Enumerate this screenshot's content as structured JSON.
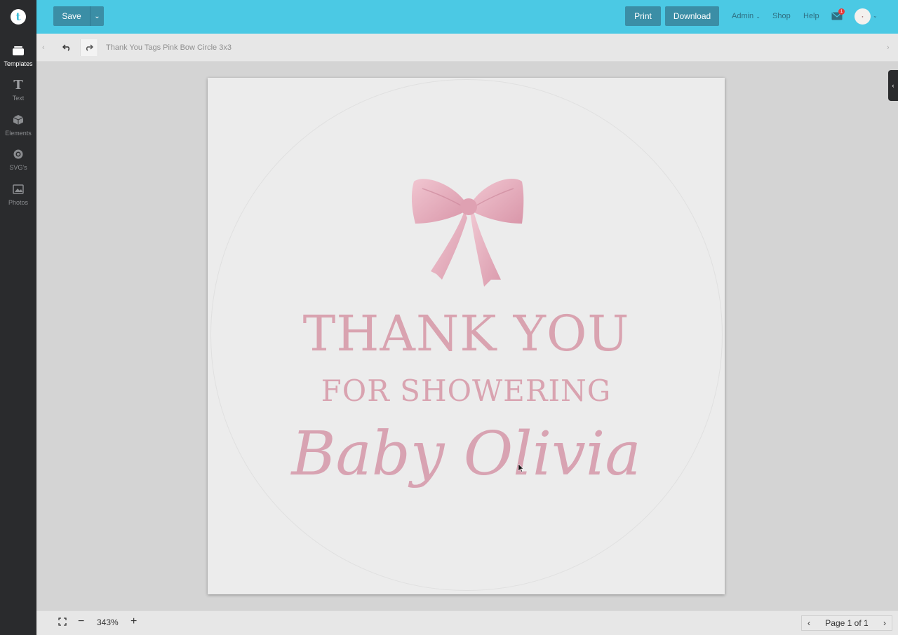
{
  "app": {
    "logo_letter": "t"
  },
  "sidebar": {
    "items": [
      {
        "label": "Templates",
        "icon": "templates-icon",
        "active": true
      },
      {
        "label": "Text",
        "icon": "text-icon",
        "active": false
      },
      {
        "label": "Elements",
        "icon": "elements-icon",
        "active": false
      },
      {
        "label": "SVG's",
        "icon": "svg-icon",
        "active": false
      },
      {
        "label": "Photos",
        "icon": "photos-icon",
        "active": false
      }
    ]
  },
  "topbar": {
    "save_label": "Save",
    "print_label": "Print",
    "download_label": "Download",
    "admin_label": "Admin",
    "shop_label": "Shop",
    "help_label": "Help",
    "mail_badge": "1",
    "accent_color": "#4bc9e4",
    "button_color": "#3b8ea6"
  },
  "toolbar": {
    "document_title": "Thank You Tags Pink Bow Circle 3x3"
  },
  "design": {
    "line1": "THANK YOU",
    "line2": "FOR SHOWERING",
    "line3": "Baby Olivia",
    "text_color": "#d9a3b0"
  },
  "footer": {
    "zoom": "343%",
    "page_label": "Page 1 of 1"
  }
}
